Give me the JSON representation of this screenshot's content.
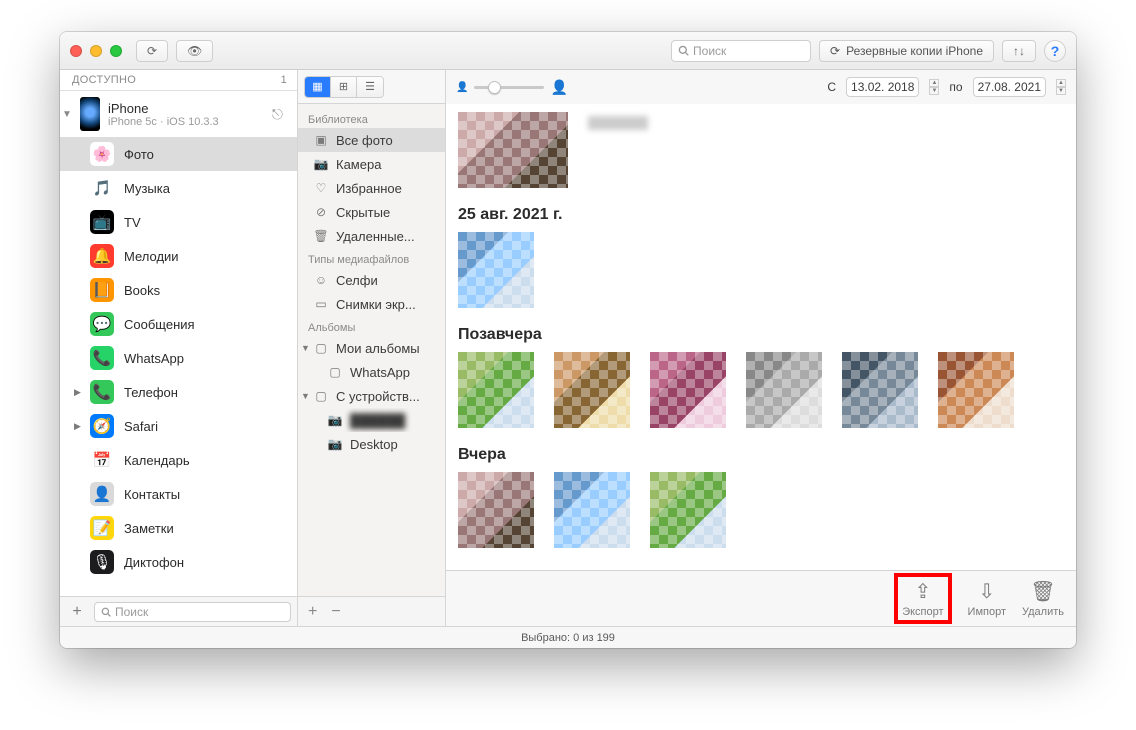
{
  "titlebar": {
    "search_placeholder": "Поиск",
    "backup_label": "Резервные копии iPhone",
    "help_label": "?"
  },
  "sidebar": {
    "header": "ДОСТУПНО",
    "header_count": "1",
    "device": {
      "name": "iPhone",
      "subtitle": "iPhone 5c · iOS 10.3.3"
    },
    "apps": [
      {
        "label": "Фото",
        "selected": true,
        "icon": "photos",
        "has_children": false
      },
      {
        "label": "Музыка",
        "icon": "music"
      },
      {
        "label": "TV",
        "icon": "tv"
      },
      {
        "label": "Мелодии",
        "icon": "ringtones"
      },
      {
        "label": "Books",
        "icon": "books"
      },
      {
        "label": "Сообщения",
        "icon": "messages"
      },
      {
        "label": "WhatsApp",
        "icon": "whatsapp"
      },
      {
        "label": "Телефон",
        "icon": "phone",
        "has_children": true
      },
      {
        "label": "Safari",
        "icon": "safari",
        "has_children": true
      },
      {
        "label": "Календарь",
        "icon": "calendar"
      },
      {
        "label": "Контакты",
        "icon": "contacts"
      },
      {
        "label": "Заметки",
        "icon": "notes"
      },
      {
        "label": "Диктофон",
        "icon": "voicememo"
      }
    ],
    "footer": {
      "add": "+",
      "search_placeholder": "Поиск"
    }
  },
  "library": {
    "sections": [
      {
        "title": "Библиотека",
        "items": [
          {
            "label": "Все фото",
            "icon": "photo",
            "selected": true
          },
          {
            "label": "Камера",
            "icon": "camera"
          },
          {
            "label": "Избранное",
            "icon": "heart"
          },
          {
            "label": "Скрытые",
            "icon": "hidden"
          },
          {
            "label": "Удаленные...",
            "icon": "trash"
          }
        ]
      },
      {
        "title": "Типы медиафайлов",
        "items": [
          {
            "label": "Селфи",
            "icon": "selfie"
          },
          {
            "label": "Снимки экр...",
            "icon": "screenshot"
          }
        ]
      },
      {
        "title": "Альбомы",
        "items": [
          {
            "label": "Мои альбомы",
            "icon": "folder",
            "tri": "▼"
          },
          {
            "label": "WhatsApp",
            "icon": "folder",
            "indent": true
          },
          {
            "label": "С устройств...",
            "icon": "folder",
            "tri": "▼"
          },
          {
            "label": "",
            "icon": "camera",
            "indent": true,
            "blurred": true
          },
          {
            "label": "Desktop",
            "icon": "camera",
            "indent": true
          }
        ]
      }
    ],
    "footer": {
      "add": "+",
      "remove": "−"
    }
  },
  "maintoolbar": {
    "from_label": "С",
    "date_from": "13.02. 2018",
    "to_label": "по",
    "date_to": "27.08. 2021"
  },
  "groups": [
    {
      "title": "",
      "count": 1,
      "first": true,
      "with_label": true
    },
    {
      "title": "25 авг. 2021 г.",
      "count": 1
    },
    {
      "title": "Позавчера",
      "count": 6
    },
    {
      "title": "Вчера",
      "count": 3
    }
  ],
  "footer_buttons": {
    "export": "Экспорт",
    "import": "Импорт",
    "delete": "Удалить"
  },
  "statusbar": "Выбрано: 0 из 199"
}
